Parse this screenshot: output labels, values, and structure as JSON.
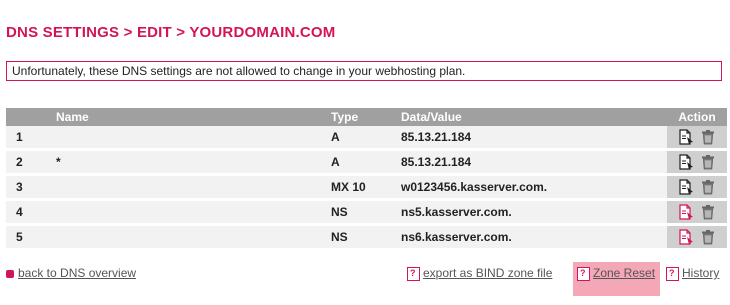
{
  "page_title": "DNS SETTINGS > EDIT > YOURDOMAIN.COM",
  "notice": "Unfortunately, these DNS settings are not allowed to change in your webhosting plan.",
  "table": {
    "headers": {
      "name": "Name",
      "type": "Type",
      "value": "Data/Value",
      "action": "Action"
    },
    "rows": [
      {
        "id": "1",
        "name": "",
        "type": "A",
        "value": "85.13.21.184",
        "edit_icon_color": "#222222"
      },
      {
        "id": "2",
        "name": "*",
        "type": "A",
        "value": "85.13.21.184",
        "edit_icon_color": "#222222"
      },
      {
        "id": "3",
        "name": "",
        "type": "MX 10",
        "value": "w0123456.kasserver.com.",
        "edit_icon_color": "#222222"
      },
      {
        "id": "4",
        "name": "",
        "type": "NS",
        "value": "ns5.kasserver.com.",
        "edit_icon_color": "#d4145a"
      },
      {
        "id": "5",
        "name": "",
        "type": "NS",
        "value": "ns6.kasserver.com.",
        "edit_icon_color": "#d4145a"
      }
    ]
  },
  "footer": {
    "back_label": "back to DNS overview",
    "export_label": "export as BIND zone file",
    "reset_label": "Zone Reset",
    "history_label": "History"
  },
  "colors": {
    "accent": "#d4145a",
    "header_bg": "#a0a0a0",
    "row_bg": "#f2f2f2",
    "action_bg": "#cfcfcf",
    "reset_highlight": "#f4a7b6"
  },
  "icons": {
    "edit": "edit-document-icon",
    "delete": "trash-icon",
    "back": "back-square-icon",
    "help": "question-document-icon"
  }
}
